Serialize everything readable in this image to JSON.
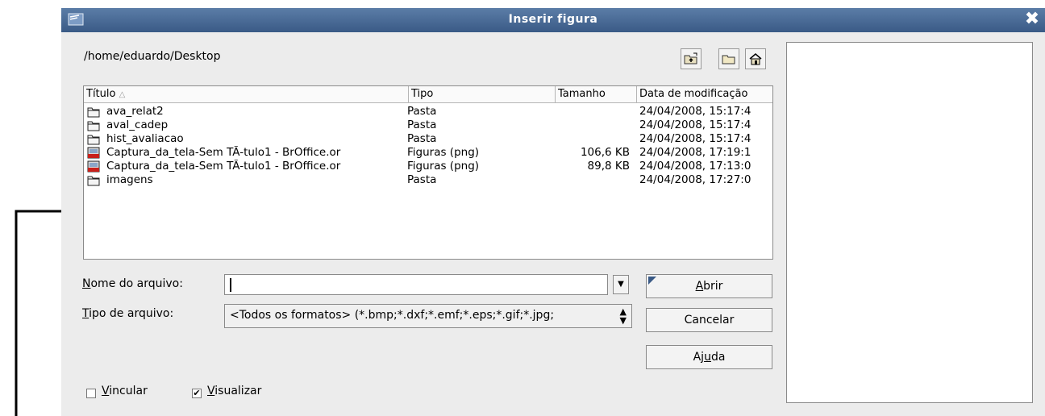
{
  "window": {
    "title": "Inserir figura",
    "close_glyph": "✖"
  },
  "path": "/home/eduardo/Desktop",
  "toolbar": {
    "up_icon": "folder-up-icon",
    "new_folder_icon": "new-folder-icon",
    "home_icon": "home-icon"
  },
  "columns": {
    "title": "Título",
    "type": "Tipo",
    "size": "Tamanho",
    "date": "Data de modificação"
  },
  "files": [
    {
      "name": "ava_relat2",
      "type": "Pasta",
      "size": "",
      "date": "24/04/2008, 15:17:4",
      "icon": "folder-icon"
    },
    {
      "name": "aval_cadep",
      "type": "Pasta",
      "size": "",
      "date": "24/04/2008, 15:17:4",
      "icon": "folder-icon"
    },
    {
      "name": "hist_avaliacao",
      "type": "Pasta",
      "size": "",
      "date": "24/04/2008, 15:17:4",
      "icon": "folder-icon"
    },
    {
      "name": "Captura_da_tela-Sem TÃ-tulo1 - BrOffice.or",
      "type": "Figuras (png)",
      "size": "106,6 KB",
      "date": "24/04/2008, 17:19:1",
      "icon": "png-file-icon"
    },
    {
      "name": "Captura_da_tela-Sem TÃ-tulo1 - BrOffice.or",
      "type": "Figuras (png)",
      "size": "89,8 KB",
      "date": "24/04/2008, 17:13:0",
      "icon": "png-file-icon"
    },
    {
      "name": "imagens",
      "type": "Pasta",
      "size": "",
      "date": "24/04/2008, 17:27:0",
      "icon": "folder-icon"
    }
  ],
  "form": {
    "filename_label_pre": "",
    "filename_label_key": "N",
    "filename_label_post": "ome do arquivo:",
    "filename_value": "",
    "filetype_label_key": "T",
    "filetype_label_post": "ipo de arquivo:",
    "filetype_value": "<Todos os formatos> (*.bmp;*.dxf;*.emf;*.eps;*.gif;*.jpg;"
  },
  "buttons": {
    "open_key": "A",
    "open_rest": "brir",
    "cancel": "Cancelar",
    "help_pre": "Aj",
    "help_key": "u",
    "help_post": "da"
  },
  "options": {
    "link_key": "V",
    "link_rest": "incular",
    "link_checked": false,
    "preview_key": "V",
    "preview_rest": "isualizar",
    "preview_checked": true,
    "checkmark": "✔"
  }
}
